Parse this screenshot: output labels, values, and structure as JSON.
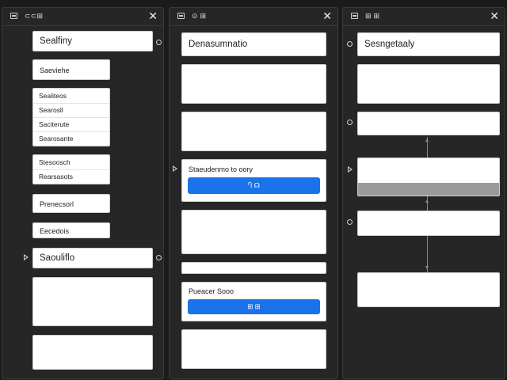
{
  "panels": [
    {
      "title": "⊂⊂⊞",
      "close": "✕",
      "cards": {
        "header": "Sealfiny",
        "single": "Saeviehe",
        "group1": [
          "Sealiteos",
          "Searosll",
          "Saciterute",
          "Searosante"
        ],
        "group2": [
          "Stesoosch",
          "Rearsasots"
        ],
        "single2": "Prenecsorl",
        "single3": "Eecedois",
        "section": "Saouliflo"
      }
    },
    {
      "title": "⊙ ⊞",
      "close": "✕",
      "cards": {
        "header": "Denasumnatio",
        "action1_label": "Staeudenmo to oory",
        "action1_button": "Ⴄ ☊",
        "action2_label": "Pueacer Sooo",
        "action2_button": "⊞ ⊞"
      }
    },
    {
      "title": "⊞ ⊞",
      "close": "✕",
      "cards": {
        "header": "Sesngetaaly"
      }
    }
  ],
  "colors": {
    "background": "#1b1b1c",
    "panel": "#262627",
    "card": "#ffffff",
    "accent": "#1a73e8"
  }
}
